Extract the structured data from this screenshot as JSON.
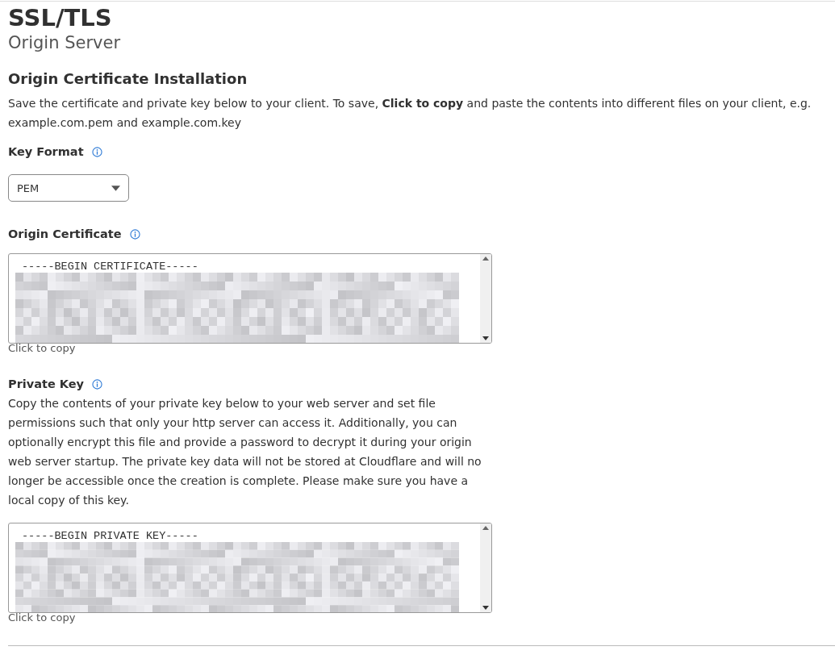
{
  "page": {
    "title": "SSL/TLS",
    "subtitle": "Origin Server"
  },
  "section": {
    "heading": "Origin Certificate Installation",
    "intro": "Save the certificate and private key below to your client. To save, **Click to copy** and paste the contents into different files on your client, e.g. example.com.pem and example.com.key"
  },
  "key_format": {
    "label": "Key Format",
    "value": "PEM"
  },
  "certificate": {
    "label": "Origin Certificate",
    "first_line": "-----BEGIN CERTIFICATE-----",
    "copy_hint": "Click to copy"
  },
  "private_key": {
    "label": "Private Key",
    "description": "Copy the contents of your private key below to your web server and set file permissions such that only your http server can access it. Additionally, you can optionally encrypt this file and provide a password to decrypt it during your origin web server startup. The private key data will not be stored at Cloudflare and will no longer be accessible once the creation is complete. Please make sure you have a local copy of this key.",
    "first_line": "-----BEGIN PRIVATE KEY-----",
    "copy_hint": "Click to copy"
  }
}
